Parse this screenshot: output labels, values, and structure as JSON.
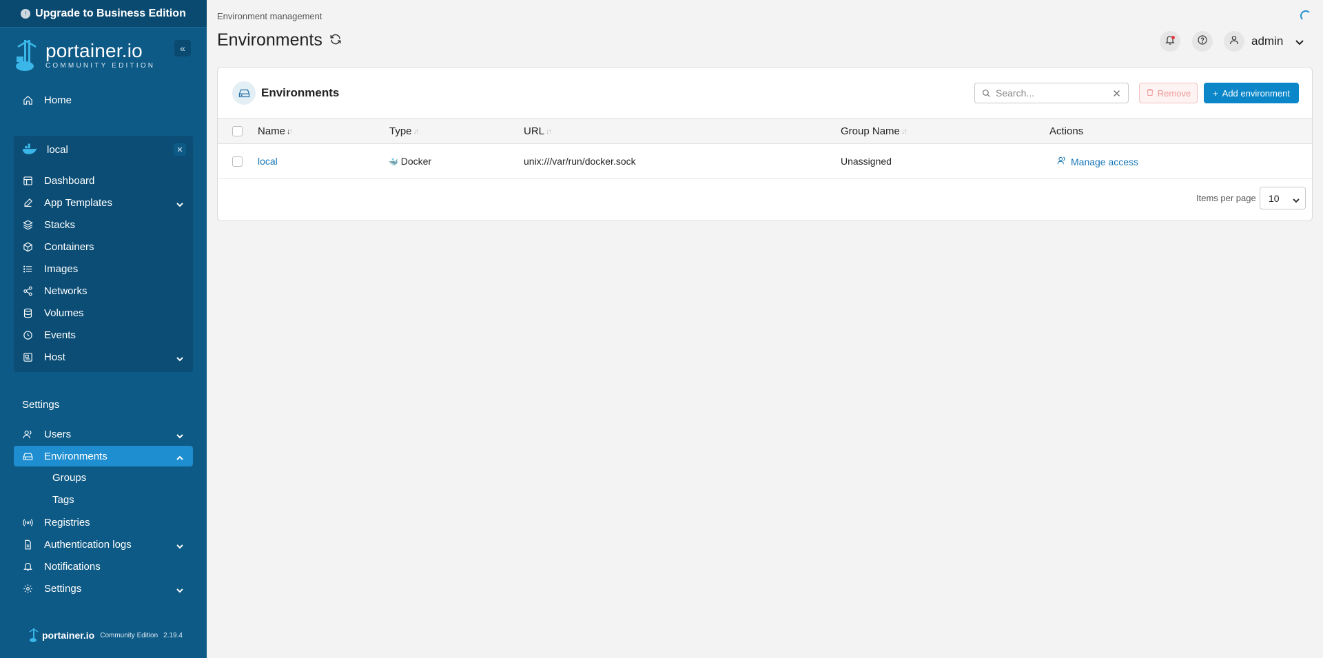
{
  "upgrade_banner": "Upgrade to Business Edition",
  "brand": {
    "name": "portainer.io",
    "edition": "COMMUNITY EDITION"
  },
  "environment": {
    "name": "local",
    "nav": [
      {
        "label": "Dashboard",
        "icon": "dashboard-icon"
      },
      {
        "label": "App Templates",
        "icon": "edit-icon"
      },
      {
        "label": "Stacks",
        "icon": "layers-icon"
      },
      {
        "label": "Containers",
        "icon": "box-icon"
      },
      {
        "label": "Images",
        "icon": "list-icon"
      },
      {
        "label": "Networks",
        "icon": "share-icon"
      },
      {
        "label": "Volumes",
        "icon": "database-icon"
      },
      {
        "label": "Events",
        "icon": "clock-icon"
      },
      {
        "label": "Host",
        "icon": "server-icon"
      }
    ]
  },
  "sidebar": {
    "home": "Home",
    "settings_title": "Settings",
    "settings_nav": [
      {
        "label": "Users"
      },
      {
        "label": "Environments"
      },
      {
        "label": "Groups"
      },
      {
        "label": "Tags"
      },
      {
        "label": "Registries"
      },
      {
        "label": "Authentication logs"
      },
      {
        "label": "Notifications"
      },
      {
        "label": "Settings"
      }
    ]
  },
  "footer": {
    "brand": "portainer.io",
    "edition": "Community Edition",
    "version": "2.19.4"
  },
  "header": {
    "breadcrumb": "Environment management",
    "title": "Environments",
    "user": "admin"
  },
  "card": {
    "title": "Environments",
    "search_placeholder": "Search...",
    "remove_label": "Remove",
    "add_label": "Add environment",
    "columns": [
      "Name",
      "Type",
      "URL",
      "Group Name",
      "Actions"
    ],
    "rows": [
      {
        "name": "local",
        "type": "Docker",
        "url": "unix:///var/run/docker.sock",
        "group": "Unassigned",
        "action": "Manage access"
      }
    ],
    "items_per_page_label": "Items per page",
    "items_per_page": "10"
  },
  "colors": {
    "sidebar": "#0e5a86",
    "accent": "#1f8ed1",
    "primary_button": "#0b87c9",
    "link": "#1676b6"
  }
}
